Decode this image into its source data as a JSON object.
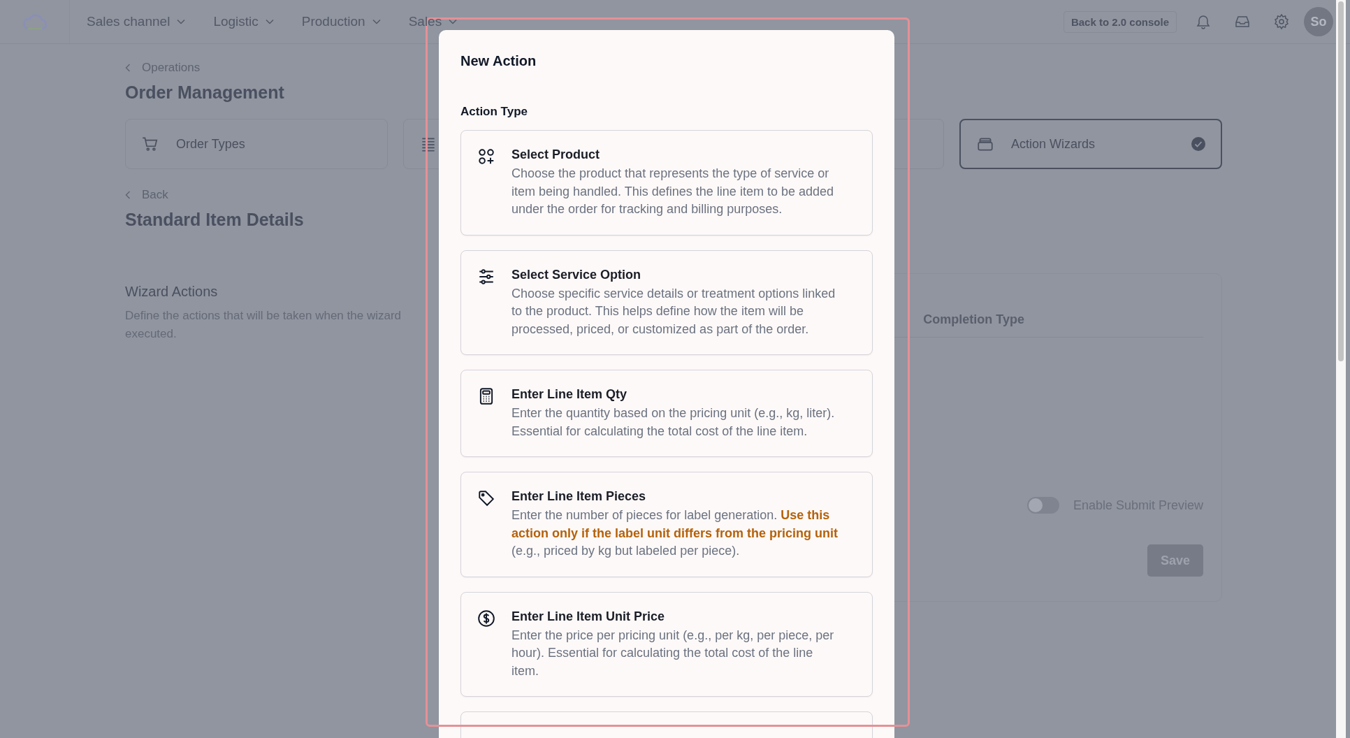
{
  "nav": {
    "menus": [
      {
        "label": "Sales channel"
      },
      {
        "label": "Logistic"
      },
      {
        "label": "Production"
      },
      {
        "label": "Sales"
      }
    ],
    "console_button": "Back to 2.0 console",
    "avatar": "So"
  },
  "breadcrumb": "Operations",
  "page_title": "Order Management",
  "section_cards": [
    {
      "label": "Order Types",
      "selected": false
    },
    {
      "selected": false
    },
    {
      "selected": false
    },
    {
      "label": "Action Wizards",
      "selected": true
    }
  ],
  "back_link": "Back",
  "detail_title": "Standard Item Details",
  "wizard_actions": {
    "title": "Wizard Actions",
    "description_lines": [
      "Define the actions that will be taken when the wizard",
      "executed."
    ]
  },
  "panel": {
    "column_header": "Completion Type",
    "toggle": {
      "label": "Enable Submit Preview",
      "on": false
    },
    "save_button": "Save"
  },
  "modal": {
    "title": "New Action",
    "section_label": "Action Type",
    "actions": [
      {
        "kind": "option",
        "title": "Select Product",
        "description": "Choose the product that represents the type of service or item being handled. This defines the line item to be added under the order for tracking and billing purposes."
      },
      {
        "kind": "option",
        "title": "Select Service Option",
        "description": "Choose specific service details or treatment options linked to the product. This helps define how the item will be processed, priced, or customized as part of the order."
      },
      {
        "kind": "option",
        "title": "Enter Line Item Qty",
        "description": "Enter the quantity based on the pricing unit (e.g., kg, liter). Essential for calculating the total cost of the line item."
      },
      {
        "kind": "option",
        "title": "Enter Line Item Pieces",
        "description": "Enter the number of pieces for label generation. **Use this action only if the label unit differs from the pricing unit** (e.g., priced by kg but labeled per piece)."
      },
      {
        "kind": "option",
        "title": "Enter Line Item Unit Price",
        "description": "Enter the price per pricing unit (e.g., per kg, per piece, per hour). Essential for calculating the total cost of the line item."
      },
      {
        "kind": "cut-off"
      }
    ]
  }
}
